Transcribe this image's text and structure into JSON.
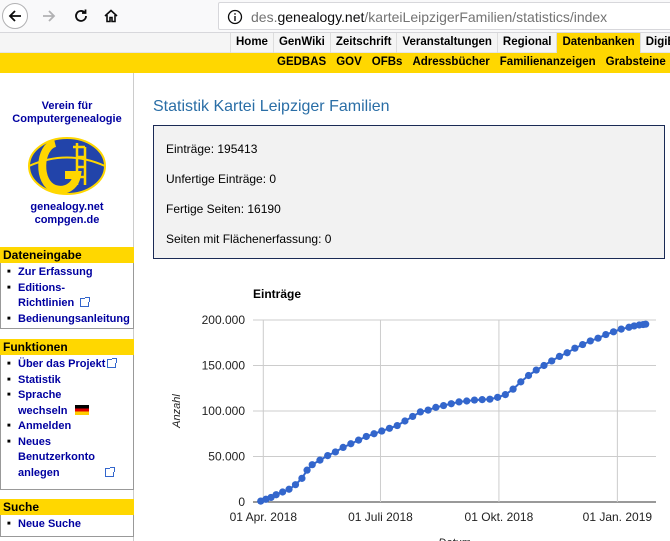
{
  "browser": {
    "url_prefix": "des.",
    "url_domain": "genealogy.net",
    "url_path": "/karteiLeipzigerFamilien/statistics/index"
  },
  "menu_primary": [
    "Home",
    "GenWiki",
    "Zeitschrift",
    "Veranstaltungen",
    "Regional",
    "Datenbanken",
    "DigiBib"
  ],
  "menu_primary_active": "Datenbanken",
  "menu_secondary": [
    "GEDBAS",
    "GOV",
    "OFBs",
    "Adressbücher",
    "Familienanzeigen",
    "Grabsteine"
  ],
  "sidebar": {
    "org_line1": "Verein für",
    "org_line2": "Computergenealogie",
    "site1": "genealogy.net",
    "site2": "compgen.de",
    "sections": [
      {
        "title": "Dateneingabe",
        "items": [
          "Zur Erfassung",
          "Editions-Richtlinien",
          "Bedienungsanleitung"
        ]
      },
      {
        "title": "Funktionen",
        "items": [
          "Über das Projekt",
          "Statistik",
          "Sprache wechseln",
          "Anmelden",
          "Neues Benutzerkonto anlegen"
        ]
      },
      {
        "title": "Suche",
        "items": [
          "Neue Suche"
        ]
      }
    ]
  },
  "main": {
    "title": "Statistik Kartei Leipziger Familien",
    "stats": [
      "Einträge: 195413",
      "Unfertige Einträge: 0",
      "Fertige Seiten: 16190",
      "Seiten mit Flächenerfassung: 0"
    ]
  },
  "chart_data": {
    "type": "line",
    "title": "Einträge",
    "xlabel": "Datum",
    "ylabel": "Anzahl",
    "ylim": [
      0,
      200000
    ],
    "yticks": [
      "0",
      "50.000",
      "100.000",
      "150.000",
      "200.000"
    ],
    "xticks": [
      "01 Apr. 2018",
      "01 Juli 2018",
      "01 Okt. 2018",
      "01 Jan. 2019"
    ],
    "xtick_days": [
      0,
      91,
      183,
      275
    ],
    "grid": true,
    "color": "#3366cc",
    "x_days": [
      -2,
      2,
      6,
      10,
      15,
      20,
      25,
      30,
      34,
      38,
      44,
      50,
      56,
      62,
      68,
      74,
      80,
      86,
      92,
      98,
      104,
      110,
      116,
      122,
      128,
      134,
      140,
      146,
      152,
      158,
      164,
      170,
      176,
      182,
      188,
      194,
      200,
      206,
      212,
      218,
      224,
      230,
      236,
      242,
      248,
      254,
      260,
      266,
      272,
      278,
      284,
      288,
      292,
      295,
      297
    ],
    "values": [
      1000,
      3000,
      5000,
      8000,
      11000,
      14000,
      19000,
      26000,
      35000,
      41000,
      46000,
      51000,
      55000,
      60000,
      64000,
      68000,
      72000,
      75000,
      78000,
      81000,
      84000,
      89000,
      94000,
      99000,
      101000,
      104000,
      106000,
      108000,
      110000,
      111000,
      112000,
      112500,
      113000,
      115000,
      118000,
      124000,
      132000,
      139000,
      145000,
      150000,
      155000,
      160000,
      164000,
      169000,
      173000,
      177000,
      180000,
      184000,
      187000,
      190000,
      192000,
      193500,
      194500,
      195000,
      195413
    ]
  }
}
